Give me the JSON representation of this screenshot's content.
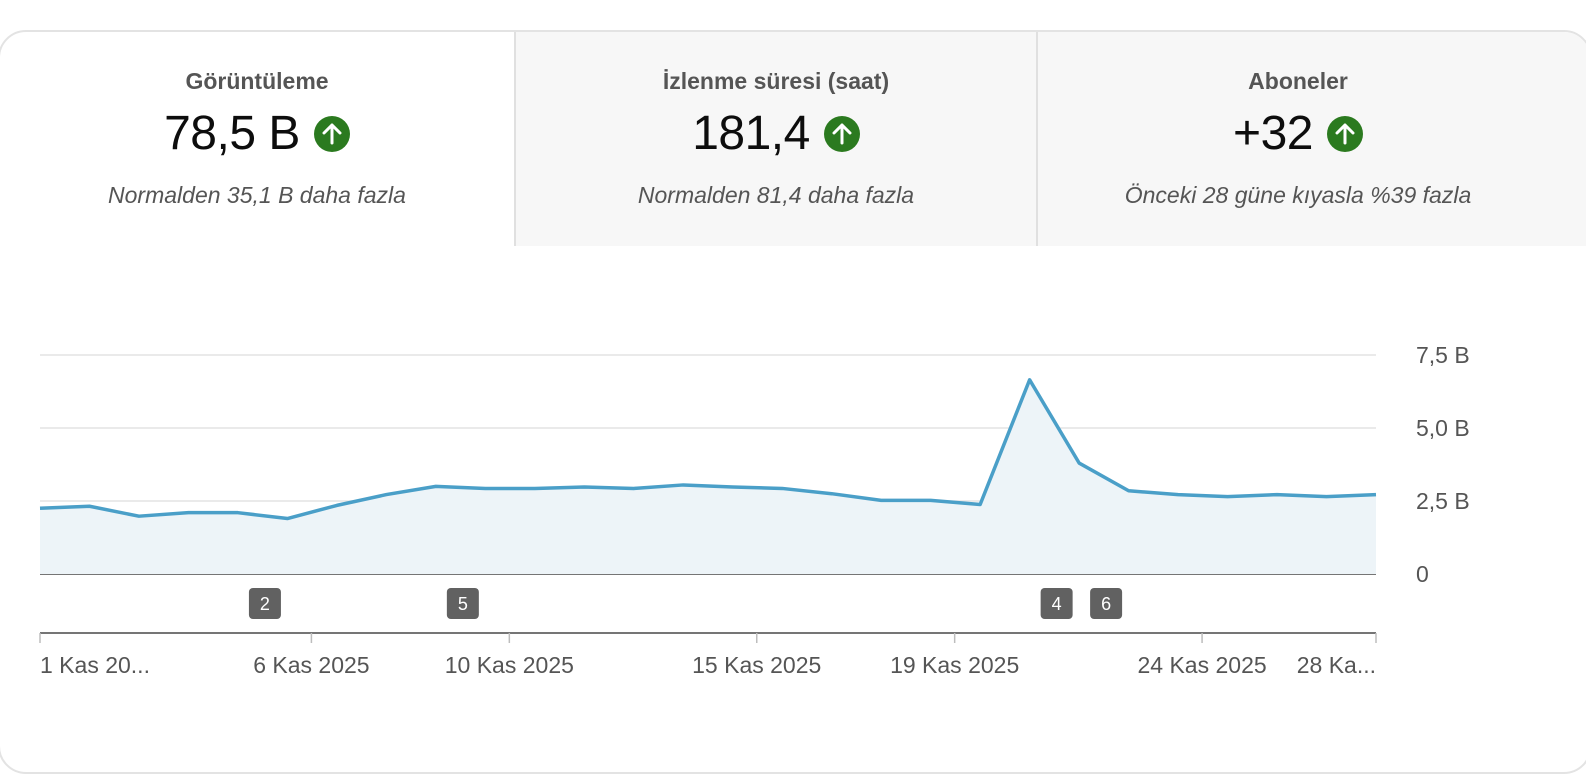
{
  "metrics": [
    {
      "title": "Görüntüleme",
      "value": "78,5 B",
      "note": "Normalden 35,1 B daha fazla",
      "trend_icon": "arrow-up-icon"
    },
    {
      "title": "İzlenme süresi (saat)",
      "value": "181,4",
      "note": "Normalden 81,4 daha fazla",
      "trend_icon": "arrow-up-icon"
    },
    {
      "title": "Aboneler",
      "value": "+32",
      "note": "Önceki 28 güne kıyasla %39 fazla",
      "trend_icon": "arrow-up-icon"
    }
  ],
  "colors": {
    "accent_line": "#4a9fc8",
    "area_fill": "#edf4f8",
    "up_badge": "#2b7a1f",
    "marker": "#616161"
  },
  "chart_data": {
    "type": "area",
    "title": "",
    "xlabel": "",
    "ylabel": "",
    "x_count": 28,
    "values": [
      2.25,
      2.32,
      1.98,
      2.1,
      2.1,
      1.9,
      2.35,
      2.72,
      3.0,
      2.93,
      2.93,
      2.98,
      2.93,
      3.05,
      2.98,
      2.93,
      2.75,
      2.52,
      2.52,
      2.38,
      6.65,
      3.8,
      2.85,
      2.72,
      2.65,
      2.72,
      2.65,
      2.72
    ],
    "ylim": [
      0,
      7.5
    ],
    "y_ticks": [
      {
        "v": 0,
        "label": "0"
      },
      {
        "v": 2.5,
        "label": "2,5 B"
      },
      {
        "v": 5,
        "label": "5,0 B"
      },
      {
        "v": 7.5,
        "label": "7,5 B"
      }
    ],
    "x_ticks": [
      {
        "i": 0,
        "label": "1 Kas 20..."
      },
      {
        "i": 5,
        "label": "6 Kas 2025"
      },
      {
        "i": 9,
        "label": "10 Kas 2025"
      },
      {
        "i": 14,
        "label": "15 Kas 2025"
      },
      {
        "i": 18,
        "label": "19 Kas 2025"
      },
      {
        "i": 23,
        "label": "24 Kas 2025"
      },
      {
        "i": 27,
        "label": "28 Ka..."
      }
    ],
    "markers": [
      {
        "i": 4,
        "label": "2"
      },
      {
        "i": 8,
        "label": "5"
      },
      {
        "i": 20,
        "label": "4"
      },
      {
        "i": 21,
        "label": "6"
      }
    ],
    "grid": true
  }
}
